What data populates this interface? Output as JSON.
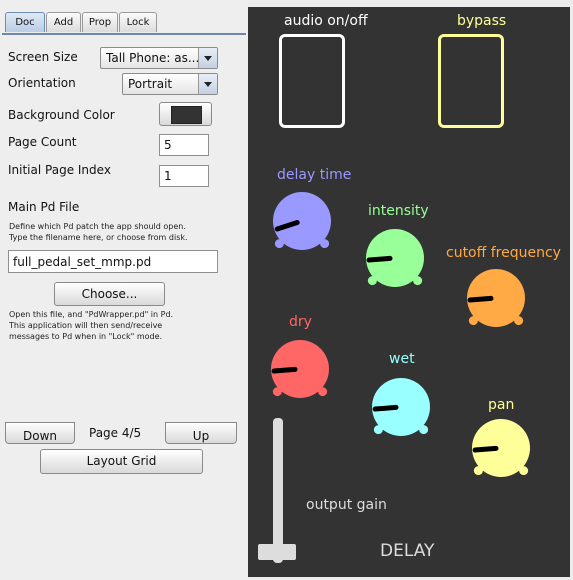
{
  "tabs": [
    {
      "label": "Doc",
      "active": true
    },
    {
      "label": "Add",
      "active": false
    },
    {
      "label": "Prop",
      "active": false
    },
    {
      "label": "Lock",
      "active": false
    }
  ],
  "doc": {
    "screen_size_label": "Screen Size",
    "screen_size_value": "Tall Phone: as...",
    "orientation_label": "Orientation",
    "orientation_value": "Portrait",
    "background_color_label": "Background Color",
    "background_color": "#333333",
    "page_count_label": "Page Count",
    "page_count_value": "5",
    "initial_page_label": "Initial Page Index",
    "initial_page_value": "1",
    "main_pd_label": "Main Pd File",
    "main_pd_help_1": "Define which Pd patch the app should open.",
    "main_pd_help_2": "Type the filename here, or choose from disk.",
    "main_pd_value": "full_pedal_set_mmp.pd",
    "choose_button": "Choose...",
    "open_help_1": "Open this file, and \"PdWrapper.pd\" in Pd.",
    "open_help_2": "This application will then send/receive",
    "open_help_3": "messages to Pd when in \"Lock\" mode."
  },
  "nav": {
    "down_button": "Down",
    "page_indicator": "Page 4/5",
    "up_button": "Up",
    "layout_grid_button": "Layout Grid"
  },
  "patch": {
    "background": "#333333",
    "audio_label": "audio on/off",
    "bypass_label": "bypass",
    "delay_time_label": "delay time",
    "intensity_label": "intensity",
    "cutoff_label": "cutoff frequency",
    "dry_label": "dry",
    "wet_label": "wet",
    "pan_label": "pan",
    "output_gain_label": "output gain",
    "title": "DELAY"
  },
  "colors": {
    "audio": "#ffffff",
    "bypass": "#ffff99",
    "delay_time": "#9999ff",
    "intensity": "#99ff99",
    "cutoff": "#ffaa44",
    "dry": "#ff6666",
    "wet": "#99ffff",
    "pan": "#ffff99",
    "output_gain": "#dddddd",
    "title": "#dddddd"
  },
  "knob_values": {
    "delay_time": 0.1,
    "intensity": 0.15,
    "cutoff": 0.15,
    "dry": 0.15,
    "wet": 0.15,
    "pan": 0.15
  },
  "output_gain_level": 0.0
}
